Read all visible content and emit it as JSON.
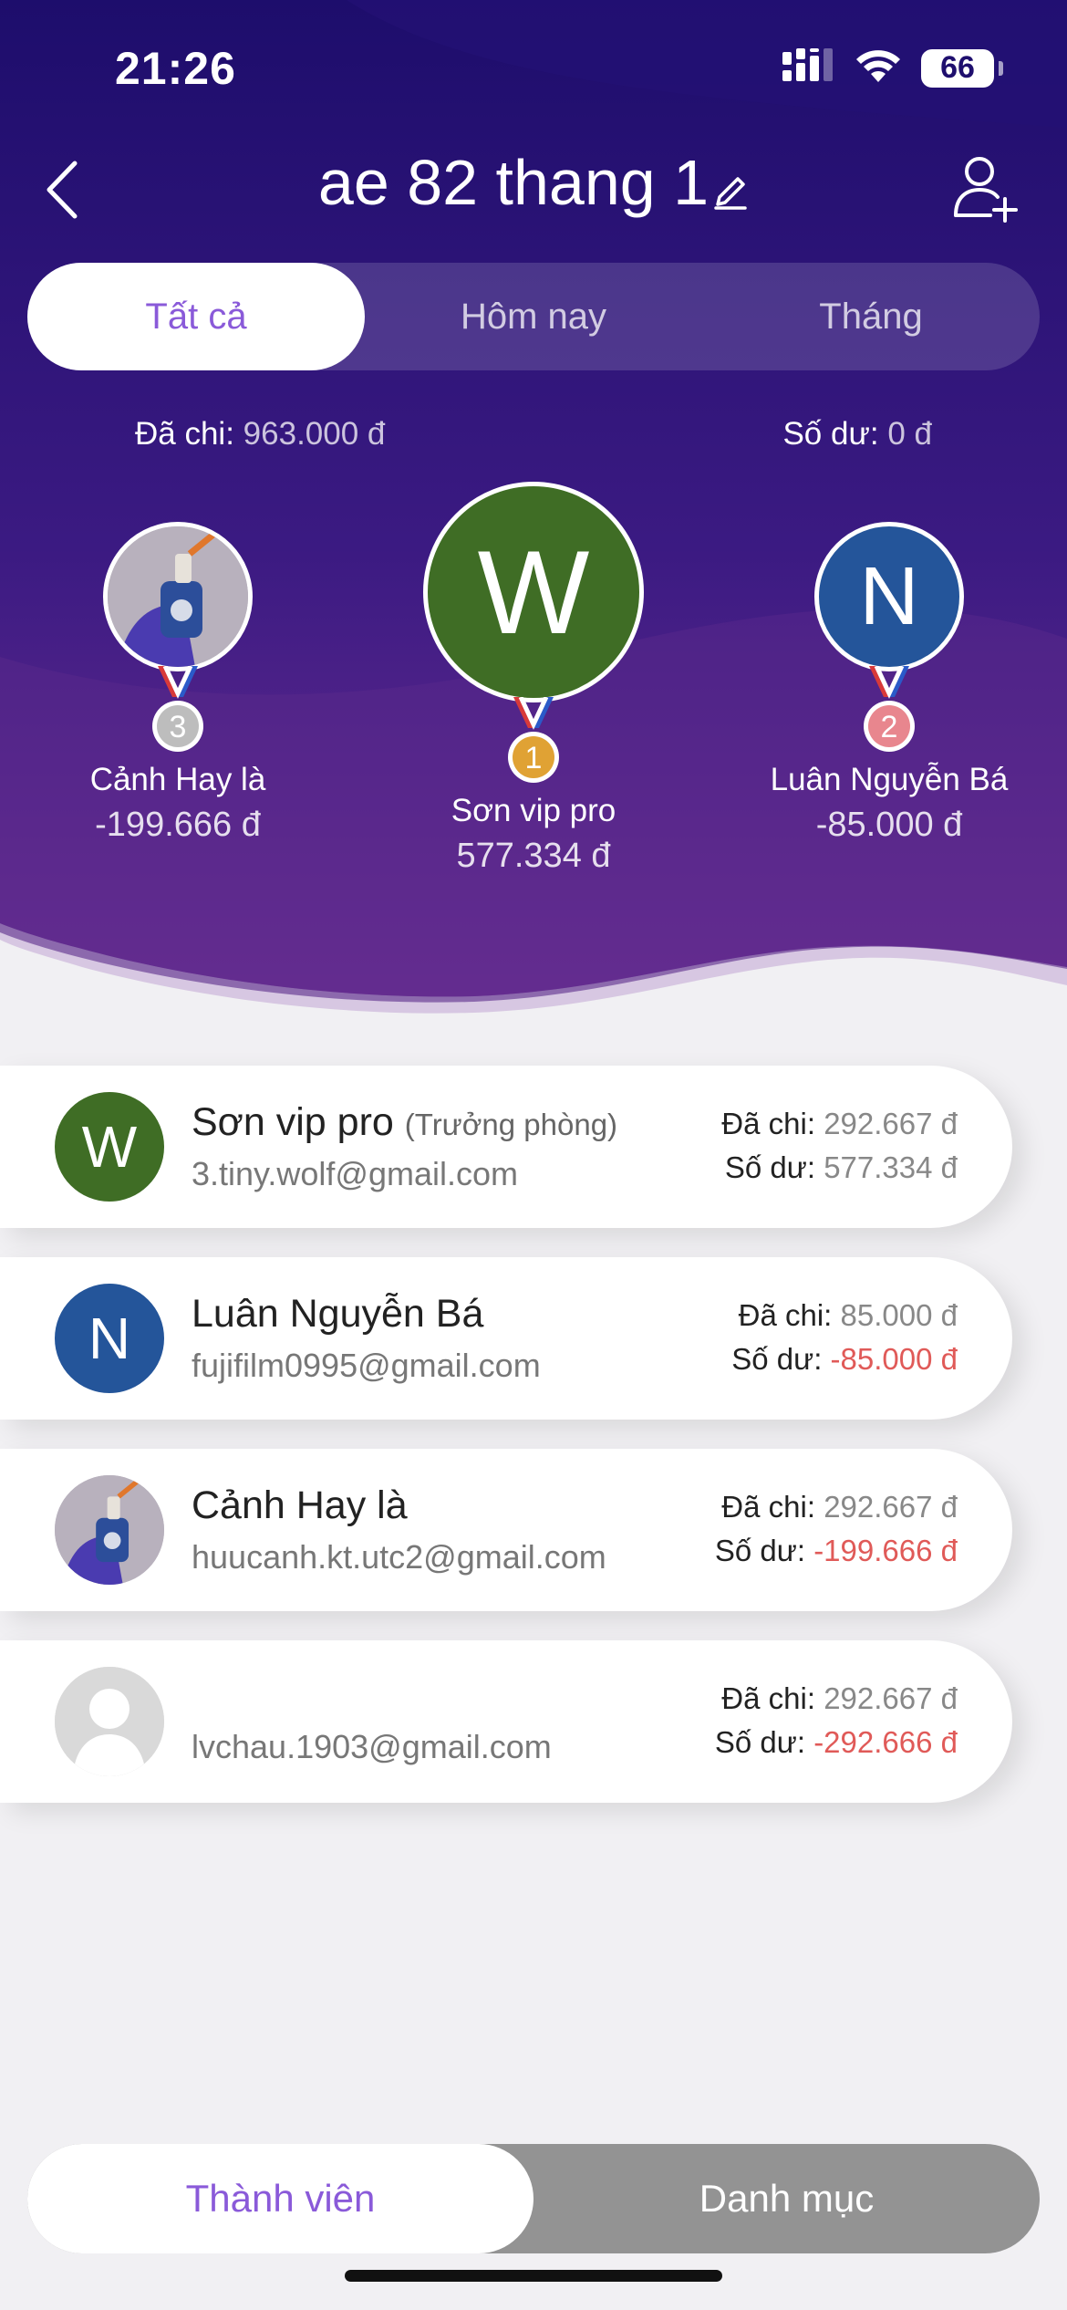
{
  "status_bar": {
    "time": "21:26",
    "battery": "66"
  },
  "header": {
    "title": "ae 82 thang 1"
  },
  "tabs": [
    {
      "label": "Tất cả",
      "active": true
    },
    {
      "label": "Hôm nay",
      "active": false
    },
    {
      "label": "Tháng",
      "active": false
    }
  ],
  "summary": {
    "spent_label": "Đã chi:",
    "spent_value": "963.000 đ",
    "balance_label": "Số dư:",
    "balance_value": "0 đ"
  },
  "podium": [
    {
      "rank": "1",
      "initial": "W",
      "name": "Sơn vip pro",
      "amount": "577.334 đ",
      "medal_color": "#e0a234"
    },
    {
      "rank": "2",
      "initial": "N",
      "name": "Luân Nguyễn Bá",
      "amount": "-85.000 đ",
      "medal_color": "#e8868e"
    },
    {
      "rank": "3",
      "initial": "",
      "name": "Cảnh Hay là",
      "amount": "-199.666 đ",
      "medal_color": "#bdbdbd"
    }
  ],
  "members": [
    {
      "initial": "W",
      "name": "Sơn vip pro",
      "role": "(Trưởng phòng)",
      "email": "3.tiny.wolf@gmail.com",
      "spent_label": "Đã chi:",
      "spent": "292.667 đ",
      "balance_label": "Số dư:",
      "balance": "577.334 đ",
      "avatar_color": "#3f6d25"
    },
    {
      "initial": "N",
      "name": "Luân Nguyễn Bá",
      "role": "",
      "email": "fujifilm0995@gmail.com",
      "spent_label": "Đã chi:",
      "spent": "85.000 đ",
      "balance_label": "Số dư:",
      "balance": "-85.000 đ",
      "avatar_color": "#24559a"
    },
    {
      "initial": "",
      "name": "Cảnh Hay là",
      "role": "",
      "email": "huucanh.kt.utc2@gmail.com",
      "spent_label": "Đã chi:",
      "spent": "292.667 đ",
      "balance_label": "Số dư:",
      "balance": "-199.666 đ",
      "avatar_color": ""
    },
    {
      "initial": "",
      "name": "",
      "role": "",
      "email": "lvchau.1903@gmail.com",
      "spent_label": "Đã chi:",
      "spent": "292.667 đ",
      "balance_label": "Số dư:",
      "balance": "-292.666 đ",
      "avatar_color": "#d9d9d9"
    }
  ],
  "bottom_tabs": [
    {
      "label": "Thành viên",
      "active": true
    },
    {
      "label": "Danh mục",
      "active": false
    }
  ],
  "colors": {
    "header_dark": "#1f0f6e",
    "header_light": "#6c2f93",
    "accent": "#8a5ad9",
    "negative": "#e05a58"
  },
  "icons": [
    "chevron-left-icon",
    "edit-pencil-icon",
    "add-user-icon",
    "signal-icon",
    "wifi-icon",
    "battery-icon",
    "medal-icon",
    "default-avatar-icon"
  ]
}
